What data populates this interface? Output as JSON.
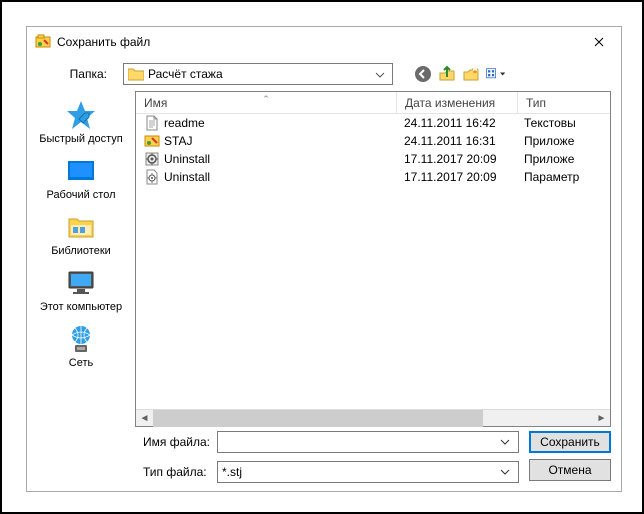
{
  "window": {
    "title": "Сохранить файл"
  },
  "folder_row": {
    "label": "Папка:",
    "current": "Расчёт стажа"
  },
  "places": {
    "quick": "Быстрый доступ",
    "desktop": "Рабочий стол",
    "libraries": "Библиотеки",
    "computer": "Этот компьютер",
    "network": "Сеть"
  },
  "columns": {
    "name": "Имя",
    "date": "Дата изменения",
    "type": "Тип"
  },
  "files": [
    {
      "icon": "text",
      "name": "readme",
      "date": "24.11.2011 16:42",
      "type": "Текстовы"
    },
    {
      "icon": "app",
      "name": "STAJ",
      "date": "24.11.2011 16:31",
      "type": "Приложе"
    },
    {
      "icon": "uninst",
      "name": "Uninstall",
      "date": "17.11.2017 20:09",
      "type": "Приложе"
    },
    {
      "icon": "cfg",
      "name": "Uninstall",
      "date": "17.11.2017 20:09",
      "type": "Параметр"
    }
  ],
  "form": {
    "filename_label": "Имя файла:",
    "filename_value": "",
    "filetype_label": "Тип файла:",
    "filetype_value": "*.stj",
    "save": "Сохранить",
    "cancel": "Отмена"
  }
}
